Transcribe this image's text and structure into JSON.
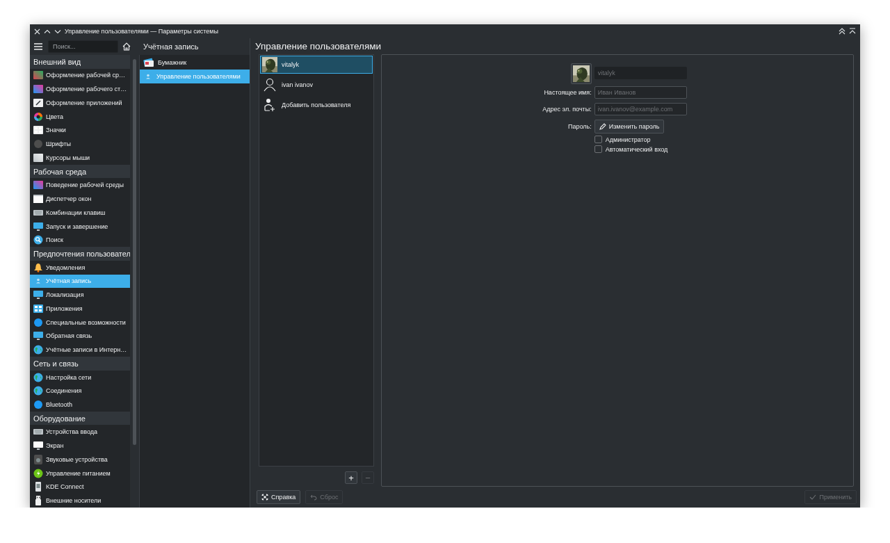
{
  "window": {
    "title": "Управление пользователями — Параметры системы"
  },
  "sidebar": {
    "search": {
      "placeholder": "Поиск..."
    },
    "groups": [
      {
        "title": "Внешний вид",
        "items": [
          {
            "label": "Оформление рабочей ср…",
            "selected": false
          },
          {
            "label": "Оформление рабочего ст…",
            "selected": false
          },
          {
            "label": "Оформление приложений",
            "selected": false
          },
          {
            "label": "Цвета",
            "selected": false
          },
          {
            "label": "Значки",
            "selected": false
          },
          {
            "label": "Шрифты",
            "selected": false
          },
          {
            "label": "Курсоры мыши",
            "selected": false
          }
        ]
      },
      {
        "title": "Рабочая среда",
        "items": [
          {
            "label": "Поведение рабочей среды",
            "selected": false
          },
          {
            "label": "Диспетчер окон",
            "selected": false
          },
          {
            "label": "Комбинации клавиш",
            "selected": false
          },
          {
            "label": "Запуск и завершение",
            "selected": false
          },
          {
            "label": "Поиск",
            "selected": false
          }
        ]
      },
      {
        "title": "Предпочтения пользовател",
        "items": [
          {
            "label": "Уведомления",
            "selected": false
          },
          {
            "label": "Учётная запись",
            "selected": true
          },
          {
            "label": "Локализация",
            "selected": false
          },
          {
            "label": "Приложения",
            "selected": false
          },
          {
            "label": "Специальные возможности",
            "selected": false
          },
          {
            "label": "Обратная связь",
            "selected": false
          },
          {
            "label": "Учётные записи в Интерн…",
            "selected": false
          }
        ]
      },
      {
        "title": "Сеть и связь",
        "items": [
          {
            "label": "Настройка сети",
            "selected": false
          },
          {
            "label": "Соединения",
            "selected": false
          },
          {
            "label": "Bluetooth",
            "selected": false
          }
        ]
      },
      {
        "title": "Оборудование",
        "items": [
          {
            "label": "Устройства ввода",
            "selected": false
          },
          {
            "label": "Экран",
            "selected": false
          },
          {
            "label": "Звуковые устройства",
            "selected": false
          },
          {
            "label": "Управление питанием",
            "selected": false
          },
          {
            "label": "KDE Connect",
            "selected": false
          },
          {
            "label": "Внешние носители",
            "selected": false
          }
        ]
      }
    ]
  },
  "subnav": {
    "title": "Учётная запись",
    "items": [
      {
        "label": "Бумажник",
        "selected": false
      },
      {
        "label": "Управление пользователями",
        "selected": true
      }
    ]
  },
  "page": {
    "title": "Управление пользователями",
    "users": [
      {
        "name": "vitalyk",
        "selected": true
      },
      {
        "name": "ivan ivanov",
        "kind": "plain",
        "selected": false
      },
      {
        "name": "Добавить пользователя",
        "kind": "action",
        "selected": false
      }
    ],
    "list_buttons": [
      "+",
      "−"
    ],
    "details": {
      "username": {
        "placeholder": "vitalyk",
        "disabled": true
      },
      "fields": [
        {
          "label": "Настоящее имя:",
          "placeholder": "Иван Иванов"
        },
        {
          "label": "Адрес эл. почты:",
          "placeholder": "ivan.ivanov@example.com"
        }
      ],
      "password": {
        "label": "Пароль:",
        "button": "Изменить пароль"
      },
      "checkboxes": [
        {
          "label": "Администратор",
          "checked": false
        },
        {
          "label": "Автоматический вход",
          "checked": false
        }
      ]
    }
  },
  "footer": {
    "buttons": [
      {
        "label": "Справка",
        "kind": "help",
        "disabled": false
      },
      {
        "label": "Сброс",
        "kind": "reset",
        "disabled": true
      },
      {
        "label": "Применить",
        "kind": "apply",
        "disabled": true
      }
    ]
  }
}
